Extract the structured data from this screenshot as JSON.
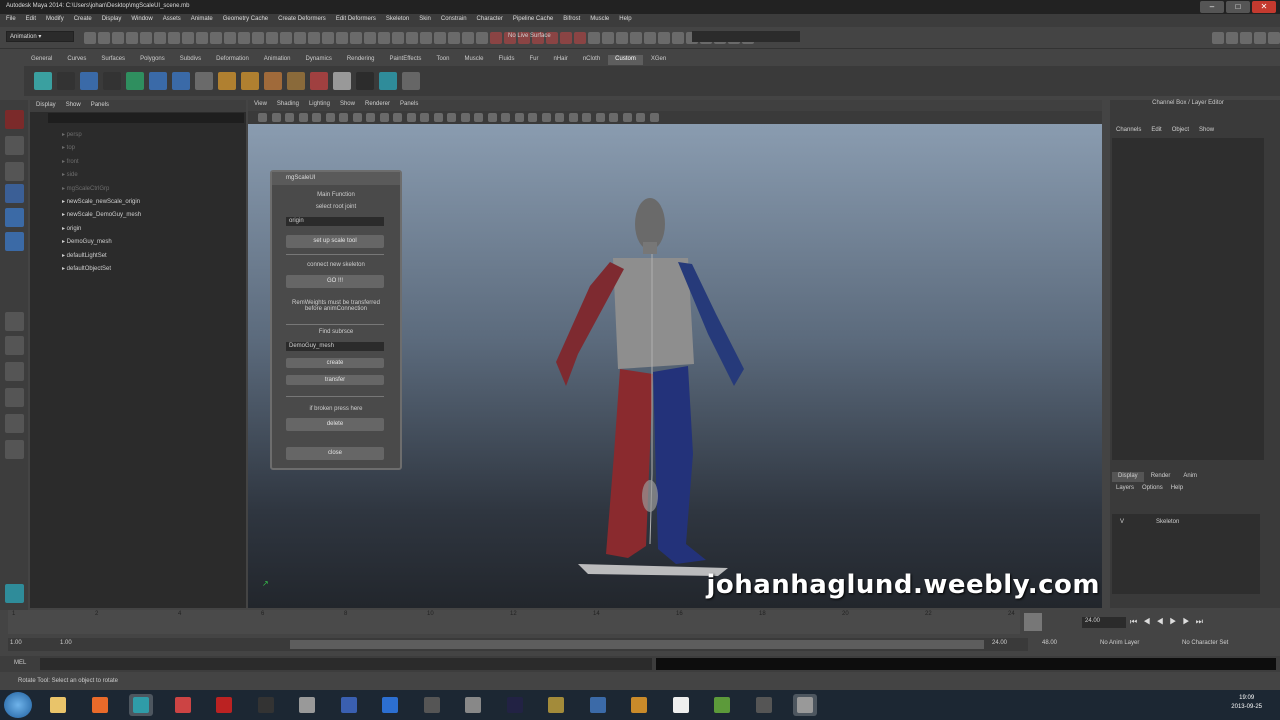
{
  "window": {
    "title": "Autodesk Maya 2014: C:\\Users\\johan\\Desktop\\mgScaleUI_scene.mb"
  },
  "menu": [
    "File",
    "Edit",
    "Modify",
    "Create",
    "Display",
    "Window",
    "Assets",
    "Animate",
    "Geometry Cache",
    "Create Deformers",
    "Edit Deformers",
    "Skeleton",
    "Skin",
    "Constrain",
    "Character",
    "Pipeline Cache",
    "Bifrost",
    "Muscle",
    "Help"
  ],
  "status": {
    "mode": "Animation",
    "live_surface": "No Live Surface"
  },
  "shelf_tabs": [
    "General",
    "Curves",
    "Surfaces",
    "Polygons",
    "Subdivs",
    "Deformation",
    "Animation",
    "Dynamics",
    "Rendering",
    "PaintEffects",
    "Toon",
    "Muscle",
    "Fluids",
    "Fur",
    "nHair",
    "nCloth",
    "Custom",
    "XGen"
  ],
  "shelf_active": "Custom",
  "outliner": {
    "menu": [
      "Display",
      "Show",
      "Panels"
    ],
    "items": [
      {
        "label": "persp",
        "dim": true
      },
      {
        "label": "top",
        "dim": true
      },
      {
        "label": "front",
        "dim": true
      },
      {
        "label": "side",
        "dim": true
      },
      {
        "label": "mgScaleCtrlGrp",
        "dim": true
      },
      {
        "label": "newScale_newScale_origin",
        "dim": false
      },
      {
        "label": "newScale_DemoGuy_mesh",
        "dim": false
      },
      {
        "label": "origin",
        "dim": false
      },
      {
        "label": "DemoGuy_mesh",
        "dim": false
      },
      {
        "label": "defaultLightSet",
        "dim": false
      },
      {
        "label": "defaultObjectSet",
        "dim": false
      }
    ]
  },
  "viewport": {
    "menu": [
      "View",
      "Shading",
      "Lighting",
      "Show",
      "Renderer",
      "Panels"
    ]
  },
  "dialog": {
    "title": "mgScaleUI",
    "main_function": "Main Function",
    "select_root": "select root joint",
    "root_value": "origin",
    "setup_button": "set up scale tool",
    "connect_label": "connect new skeleton",
    "go_button": "GO !!!",
    "note": "RemWeights must be transferred before animConnection",
    "find_label": "Find subrsce",
    "mesh_value": "DemoGuy_mesh",
    "btn_a": "create",
    "btn_b": "transfer",
    "broken_label": "if broken press here",
    "delete_button": "delete",
    "close_button": "close"
  },
  "watermark": "johanhaglund.weebly.com",
  "channel_box": {
    "header": "Channel Box / Layer Editor",
    "menu": [
      "Channels",
      "Edit",
      "Object",
      "Show"
    ],
    "layer_tabs": [
      "Display",
      "Render",
      "Anim"
    ],
    "layer_menu": [
      "Layers",
      "Options",
      "Help"
    ],
    "layer": "Skeleton",
    "layer_v": "V"
  },
  "timeline": {
    "ticks": [
      "1",
      "2",
      "4",
      "6",
      "8",
      "10",
      "12",
      "14",
      "16",
      "18",
      "20",
      "22",
      "24"
    ],
    "start": "1.00",
    "start2": "1.00",
    "end": "24.00",
    "end2": "48.00",
    "current": "24.00",
    "anim_layer": "No Anim Layer",
    "char_set": "No Character Set"
  },
  "cmd": {
    "label": "MEL"
  },
  "help_line": "Rotate Tool: Select an object to rotate",
  "clock": {
    "time": "19:09",
    "date": "2013-09-25"
  }
}
